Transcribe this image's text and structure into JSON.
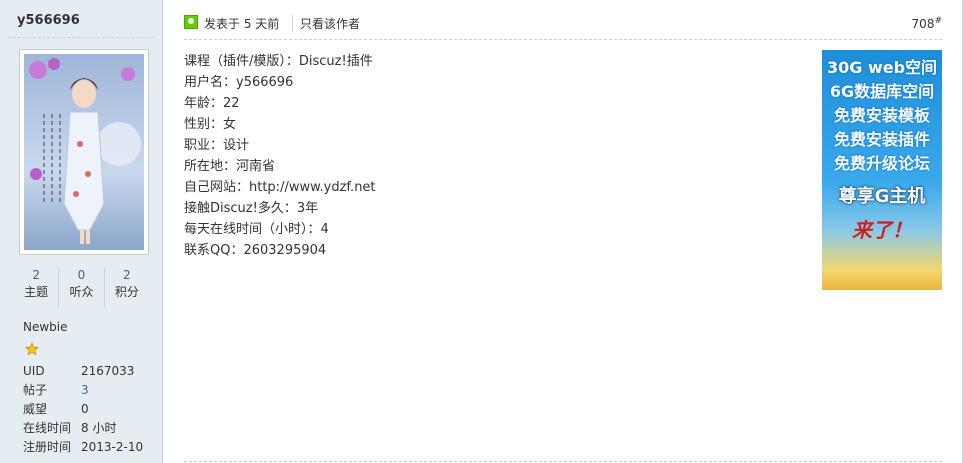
{
  "author": {
    "name": "y566696",
    "stats": [
      {
        "value": "2",
        "label": "主题"
      },
      {
        "value": "0",
        "label": "听众"
      },
      {
        "value": "2",
        "label": "积分"
      }
    ],
    "rank": "Newbie",
    "details": [
      {
        "key": "UID",
        "value": "2167033"
      },
      {
        "key": "帖子",
        "value": "3"
      },
      {
        "key": "威望",
        "value": "0"
      },
      {
        "key": "在线时间",
        "value": "8 小时"
      },
      {
        "key": "注册时间",
        "value": "2013-2-10"
      }
    ]
  },
  "post": {
    "posted": "发表于 5 天前",
    "only_author": "只看该作者",
    "floor": "708",
    "floor_sup": "#",
    "lines": [
      "课程（插件/模版）：Discuz!插件",
      "用户名：y566696",
      "年龄：22",
      "性别：女",
      "职业：设计",
      "所在地：河南省",
      "自己网站：http://www.ydzf.net",
      "接触Discuz!多久：3年",
      "每天在线时间（小时）：4",
      "联系QQ：2603295904"
    ]
  },
  "ad": {
    "lines": [
      "30G web空间",
      "6G数据库空间",
      "免费安装模板",
      "免费安装插件",
      "免费升级论坛"
    ],
    "headline": "尊享G主机",
    "tagline": "来了！"
  },
  "colors": {
    "sidebar_bg": "#e5edf2",
    "link": "#336699",
    "online": "#66cc00"
  }
}
